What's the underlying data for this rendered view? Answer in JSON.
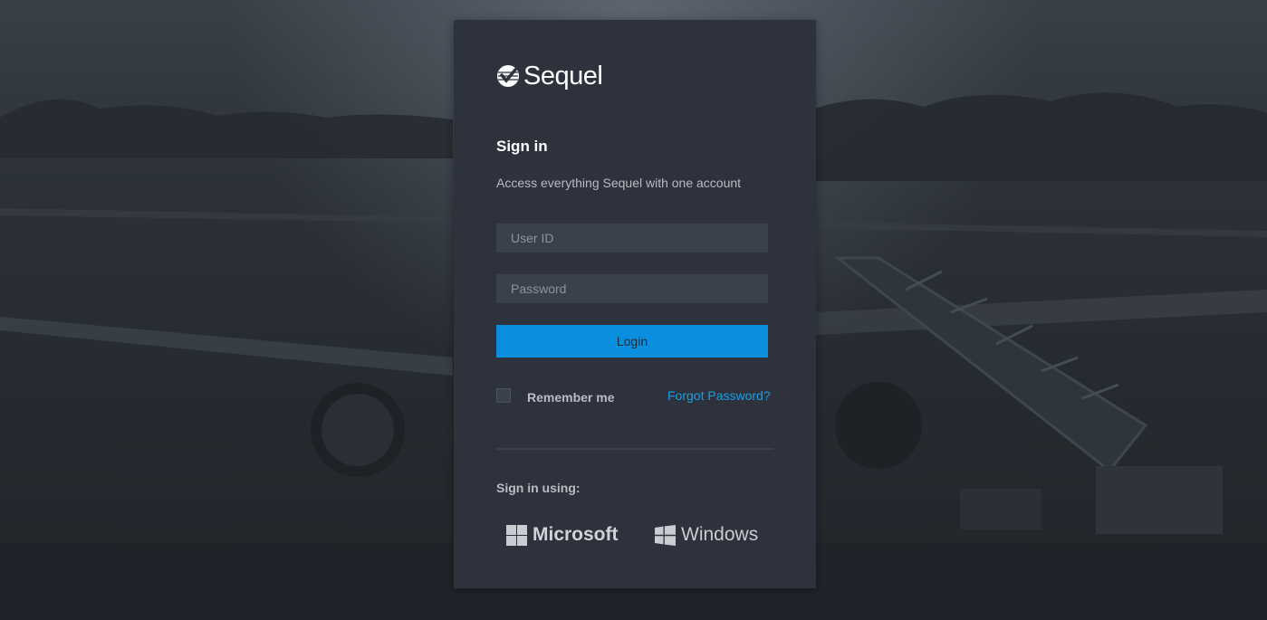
{
  "brand": {
    "name": "Sequel",
    "logo_icon": "sequel-check-logo-icon"
  },
  "signin": {
    "title": "Sign in",
    "subtitle": "Access everything Sequel with one account"
  },
  "form": {
    "userid": {
      "value": "",
      "placeholder": "User ID"
    },
    "password": {
      "value": "",
      "placeholder": "Password"
    },
    "login_label": "Login",
    "remember_label": "Remember me",
    "remember_checked": false,
    "forgot_label": "Forgot Password?"
  },
  "sso": {
    "label": "Sign in using:",
    "providers": [
      {
        "name": "Microsoft",
        "icon": "microsoft-logo-icon"
      },
      {
        "name": "Windows",
        "icon": "windows-logo-icon"
      }
    ]
  },
  "colors": {
    "accent": "#0a8fdf",
    "link": "#1b9ee6",
    "card": "#2d323c",
    "input": "#3b414b"
  }
}
